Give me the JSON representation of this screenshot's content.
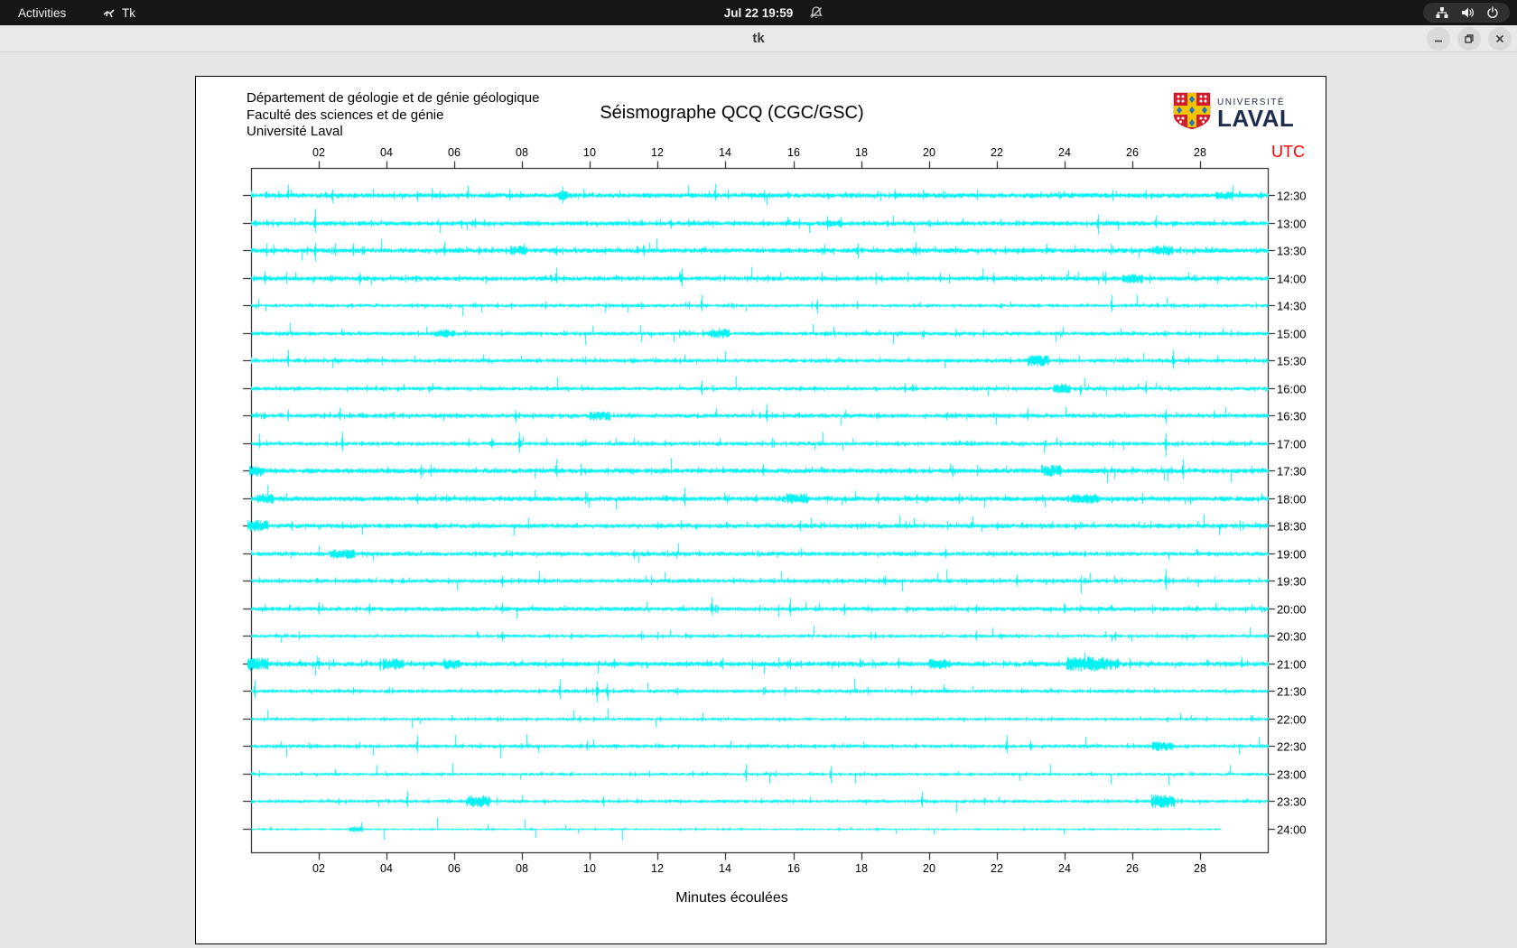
{
  "top_bar": {
    "activities_label": "Activities",
    "app_name": "Tk",
    "clock": "Jul 22 19:59"
  },
  "window": {
    "title": "tk"
  },
  "seismo": {
    "header_lines": [
      "Département de géologie et de génie géologique",
      "Faculté des sciences et de génie",
      "Université Laval"
    ],
    "title": "Séismographe QCQ (CGC/GSC)",
    "utc_label": "UTC",
    "xlabel": "Minutes écoulées",
    "logo": {
      "line1": "UNIVERSITÉ",
      "line2": "LAVAL"
    }
  },
  "chart_data": {
    "type": "line",
    "subtype": "helicorder-seismogram",
    "title": "Séismographe QCQ (CGC/GSC)",
    "xlabel": "Minutes écoulées",
    "ylabel": "UTC",
    "x_range": [
      0,
      30
    ],
    "x_ticks": [
      "02",
      "04",
      "06",
      "08",
      "10",
      "12",
      "14",
      "16",
      "18",
      "20",
      "22",
      "24",
      "26",
      "28"
    ],
    "grid": false,
    "trace_color": "#00f2f2",
    "axis_color": "#000000",
    "utc_color": "#ff0000",
    "traces": [
      {
        "label": "12:30",
        "noise": 1.5,
        "spikes": [
          [
            1.1,
            12,
            4
          ],
          [
            2.4,
            7,
            9
          ],
          [
            4.9,
            5,
            7
          ],
          [
            6.4,
            11,
            4
          ],
          [
            9.2,
            10,
            9
          ],
          [
            13.7,
            13,
            6
          ],
          [
            19.0,
            7,
            5
          ],
          [
            26.4,
            6,
            4
          ]
        ],
        "bursts": [
          [
            9.2,
            0.15,
            5
          ],
          [
            28.7,
            0.25,
            4
          ]
        ]
      },
      {
        "label": "13:00",
        "noise": 1.4,
        "spikes": [
          [
            1.9,
            16,
            10
          ],
          [
            6.6,
            6,
            5
          ],
          [
            12.4,
            5,
            6
          ],
          [
            17.0,
            8,
            7
          ],
          [
            17.4,
            7,
            5
          ],
          [
            25.0,
            10,
            12
          ],
          [
            26.7,
            9,
            5
          ]
        ],
        "bursts": [
          [
            17.2,
            0.2,
            4
          ]
        ]
      },
      {
        "label": "13:30",
        "noise": 1.5,
        "spikes": [
          [
            1.9,
            9,
            12
          ],
          [
            3.0,
            8,
            6
          ],
          [
            5.7,
            10,
            5
          ],
          [
            9.0,
            5,
            6
          ],
          [
            17.9,
            8,
            9
          ],
          [
            19.6,
            9,
            6
          ],
          [
            26.9,
            6,
            5
          ]
        ],
        "bursts": [
          [
            7.9,
            0.25,
            5
          ],
          [
            26.9,
            0.3,
            5
          ]
        ]
      },
      {
        "label": "14:00",
        "noise": 1.4,
        "spikes": [
          [
            0.4,
            8,
            6
          ],
          [
            3.2,
            6,
            7
          ],
          [
            9.0,
            12,
            5
          ],
          [
            12.7,
            11,
            9
          ],
          [
            21.9,
            6,
            5
          ],
          [
            25.2,
            8,
            6
          ]
        ],
        "bursts": [
          [
            26.0,
            0.3,
            5
          ]
        ]
      },
      {
        "label": "14:30",
        "noise": 1.0,
        "spikes": [
          [
            13.3,
            12,
            6
          ],
          [
            16.7,
            7,
            9
          ],
          [
            25.4,
            12,
            7
          ]
        ],
        "bursts": []
      },
      {
        "label": "15:00",
        "noise": 1.2,
        "spikes": [
          [
            13.8,
            6,
            5
          ],
          [
            21.6,
            5,
            4
          ]
        ],
        "bursts": [
          [
            5.7,
            0.3,
            4
          ],
          [
            13.8,
            0.3,
            5
          ]
        ]
      },
      {
        "label": "15:30",
        "noise": 1.2,
        "spikes": [
          [
            1.1,
            12,
            7
          ],
          [
            27.2,
            12,
            9
          ]
        ],
        "bursts": [
          [
            23.2,
            0.3,
            6
          ]
        ]
      },
      {
        "label": "16:00",
        "noise": 1.2,
        "spikes": [
          [
            13.3,
            9,
            7
          ],
          [
            19.3,
            6,
            5
          ],
          [
            26.4,
            8,
            6
          ]
        ],
        "bursts": [
          [
            23.9,
            0.25,
            5
          ]
        ]
      },
      {
        "label": "16:30",
        "noise": 1.3,
        "spikes": [
          [
            1.1,
            7,
            6
          ],
          [
            2.6,
            9,
            5
          ],
          [
            7.8,
            6,
            8
          ],
          [
            15.2,
            13,
            7
          ],
          [
            22.9,
            8,
            5
          ],
          [
            27.0,
            7,
            9
          ]
        ],
        "bursts": [
          [
            10.3,
            0.3,
            5
          ]
        ]
      },
      {
        "label": "17:00",
        "noise": 1.2,
        "spikes": [
          [
            2.7,
            13,
            8
          ],
          [
            7.1,
            6,
            5
          ],
          [
            7.9,
            13,
            10
          ],
          [
            27.0,
            12,
            14
          ]
        ],
        "bursts": []
      },
      {
        "label": "17:30",
        "noise": 1.5,
        "spikes": [
          [
            5.0,
            7,
            8
          ],
          [
            9.0,
            13,
            7
          ],
          [
            15.1,
            8,
            6
          ],
          [
            20.7,
            6,
            7
          ],
          [
            27.5,
            13,
            9
          ]
        ],
        "bursts": [
          [
            0.15,
            0.2,
            6
          ],
          [
            23.6,
            0.3,
            6
          ]
        ]
      },
      {
        "label": "18:00",
        "noise": 1.5,
        "spikes": [
          [
            4.9,
            6,
            6
          ],
          [
            12.8,
            12,
            8
          ],
          [
            18.5,
            7,
            5
          ],
          [
            20.9,
            6,
            6
          ]
        ],
        "bursts": [
          [
            0.4,
            0.25,
            5
          ],
          [
            16.1,
            0.3,
            6
          ],
          [
            24.6,
            0.4,
            5
          ]
        ]
      },
      {
        "label": "18:30",
        "noise": 1.4,
        "spikes": [
          [
            16.2,
            6,
            6
          ],
          [
            22.0,
            4,
            5
          ]
        ],
        "bursts": [
          [
            0.2,
            0.3,
            6
          ]
        ]
      },
      {
        "label": "19:00",
        "noise": 1.3,
        "spikes": [
          [
            11.3,
            5,
            6
          ],
          [
            20.5,
            6,
            5
          ]
        ],
        "bursts": [
          [
            2.7,
            0.35,
            5
          ]
        ]
      },
      {
        "label": "19:30",
        "noise": 1.2,
        "spikes": [
          [
            7.4,
            6,
            7
          ],
          [
            18.7,
            6,
            5
          ],
          [
            22.6,
            7,
            6
          ],
          [
            27.0,
            13,
            10
          ]
        ],
        "bursts": []
      },
      {
        "label": "20:00",
        "noise": 1.3,
        "spikes": [
          [
            2.0,
            8,
            6
          ],
          [
            3.5,
            6,
            6
          ],
          [
            7.4,
            7,
            5
          ],
          [
            13.6,
            13,
            7
          ],
          [
            15.9,
            12,
            8
          ],
          [
            17.5,
            6,
            7
          ],
          [
            21.4,
            5,
            5
          ],
          [
            24.0,
            6,
            5
          ]
        ],
        "bursts": []
      },
      {
        "label": "20:30",
        "noise": 1.0,
        "spikes": [
          [
            7.4,
            5,
            6
          ],
          [
            11.5,
            5,
            4
          ],
          [
            21.4,
            6,
            5
          ],
          [
            25.5,
            5,
            5
          ]
        ],
        "bursts": []
      },
      {
        "label": "21:00",
        "noise": 1.5,
        "spikes": [
          [
            2.0,
            7,
            6
          ],
          [
            3.8,
            6,
            8
          ],
          [
            10.7,
            6,
            5
          ],
          [
            13.9,
            7,
            6
          ],
          [
            15.9,
            6,
            6
          ],
          [
            19.1,
            7,
            5
          ]
        ],
        "bursts": [
          [
            0.2,
            0.3,
            7
          ],
          [
            4.2,
            0.3,
            6
          ],
          [
            5.9,
            0.25,
            5
          ],
          [
            20.3,
            0.3,
            5
          ],
          [
            24.6,
            0.55,
            8
          ],
          [
            25.3,
            0.3,
            6
          ]
        ]
      },
      {
        "label": "21:30",
        "noise": 1.1,
        "spikes": [
          [
            0.1,
            12,
            8
          ],
          [
            9.1,
            13,
            9
          ],
          [
            10.2,
            11,
            12
          ],
          [
            10.5,
            8,
            6
          ]
        ],
        "bursts": []
      },
      {
        "label": "22:00",
        "noise": 0.9,
        "spikes": [
          [
            9.7,
            4,
            4
          ]
        ],
        "bursts": []
      },
      {
        "label": "22:30",
        "noise": 1.1,
        "spikes": [
          [
            4.9,
            12,
            7
          ],
          [
            9.9,
            6,
            5
          ],
          [
            22.3,
            12,
            8
          ],
          [
            23.0,
            6,
            5
          ]
        ],
        "bursts": [
          [
            26.9,
            0.3,
            5
          ]
        ]
      },
      {
        "label": "23:00",
        "noise": 0.9,
        "spikes": [
          [
            14.6,
            11,
            8
          ],
          [
            17.1,
            9,
            10
          ]
        ],
        "bursts": []
      },
      {
        "label": "23:30",
        "noise": 1.0,
        "spikes": [
          [
            4.6,
            11,
            7
          ],
          [
            10.4,
            6,
            6
          ],
          [
            19.8,
            11,
            7
          ]
        ],
        "bursts": [
          [
            6.7,
            0.35,
            6
          ],
          [
            26.9,
            0.35,
            7
          ]
        ]
      },
      {
        "label": "24:00",
        "noise": 0.6,
        "spikes": [],
        "bursts": [
          [
            3.1,
            0.2,
            3
          ]
        ],
        "end": 0.953
      }
    ]
  }
}
